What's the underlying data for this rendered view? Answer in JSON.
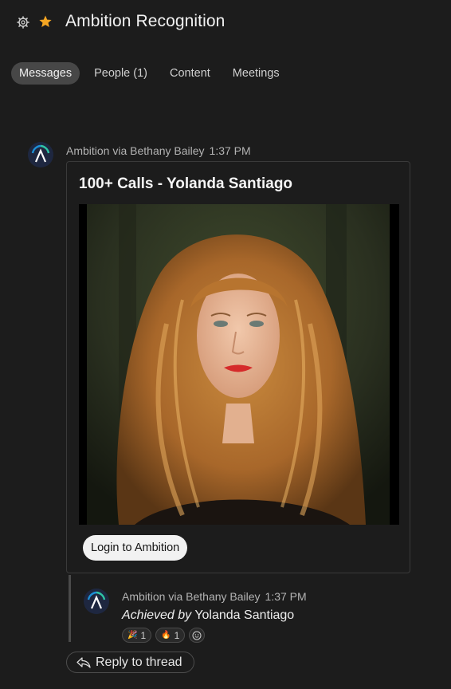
{
  "header": {
    "title": "Ambition Recognition",
    "icons": [
      "gear-icon",
      "star-icon"
    ],
    "star_color": "#f5a623"
  },
  "tabs": [
    {
      "label": "Messages",
      "active": true
    },
    {
      "label": "People (1)",
      "active": false
    },
    {
      "label": "Content",
      "active": false
    },
    {
      "label": "Meetings",
      "active": false
    }
  ],
  "message": {
    "sender": "Ambition via Bethany Bailey",
    "time": "1:37 PM",
    "card": {
      "title": "100+ Calls - Yolanda Santiago",
      "button_label": "Login to Ambition"
    }
  },
  "reply": {
    "sender": "Ambition via Bethany Bailey",
    "time": "1:37 PM",
    "text_italic": "Achieved by",
    "text_name": "Yolanda Santiago",
    "reactions": [
      {
        "emoji": "🎉",
        "count": "1"
      },
      {
        "emoji": "🔥",
        "count": "1"
      }
    ]
  },
  "thread": {
    "reply_label": "Reply to thread"
  },
  "colors": {
    "background": "#1c1c1c",
    "active_tab": "#474747",
    "brand_teal": "#2ec4a6"
  }
}
